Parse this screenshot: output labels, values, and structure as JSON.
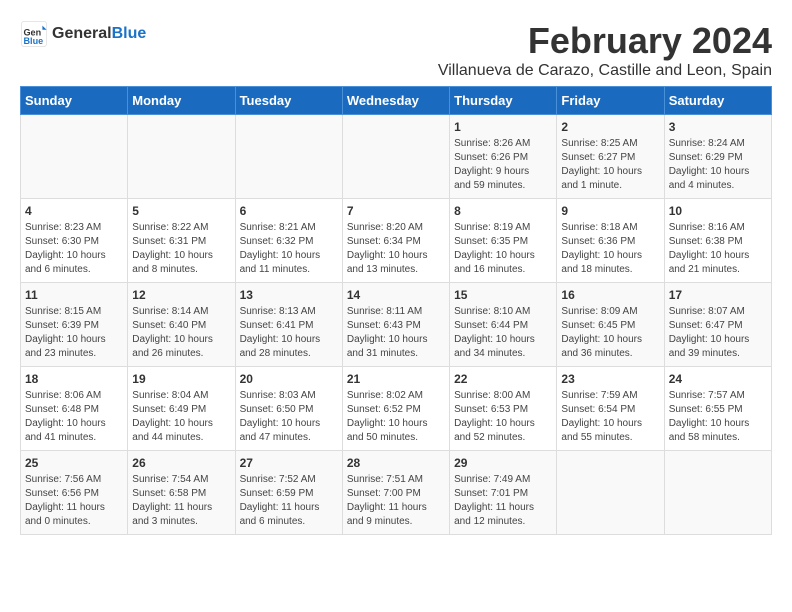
{
  "header": {
    "logo_general": "General",
    "logo_blue": "Blue",
    "title": "February 2024",
    "subtitle": "Villanueva de Carazo, Castille and Leon, Spain"
  },
  "days_of_week": [
    "Sunday",
    "Monday",
    "Tuesday",
    "Wednesday",
    "Thursday",
    "Friday",
    "Saturday"
  ],
  "weeks": [
    {
      "days": [
        {
          "number": "",
          "info": ""
        },
        {
          "number": "",
          "info": ""
        },
        {
          "number": "",
          "info": ""
        },
        {
          "number": "",
          "info": ""
        },
        {
          "number": "1",
          "info": "Sunrise: 8:26 AM\nSunset: 6:26 PM\nDaylight: 9 hours\nand 59 minutes."
        },
        {
          "number": "2",
          "info": "Sunrise: 8:25 AM\nSunset: 6:27 PM\nDaylight: 10 hours\nand 1 minute."
        },
        {
          "number": "3",
          "info": "Sunrise: 8:24 AM\nSunset: 6:29 PM\nDaylight: 10 hours\nand 4 minutes."
        }
      ]
    },
    {
      "days": [
        {
          "number": "4",
          "info": "Sunrise: 8:23 AM\nSunset: 6:30 PM\nDaylight: 10 hours\nand 6 minutes."
        },
        {
          "number": "5",
          "info": "Sunrise: 8:22 AM\nSunset: 6:31 PM\nDaylight: 10 hours\nand 8 minutes."
        },
        {
          "number": "6",
          "info": "Sunrise: 8:21 AM\nSunset: 6:32 PM\nDaylight: 10 hours\nand 11 minutes."
        },
        {
          "number": "7",
          "info": "Sunrise: 8:20 AM\nSunset: 6:34 PM\nDaylight: 10 hours\nand 13 minutes."
        },
        {
          "number": "8",
          "info": "Sunrise: 8:19 AM\nSunset: 6:35 PM\nDaylight: 10 hours\nand 16 minutes."
        },
        {
          "number": "9",
          "info": "Sunrise: 8:18 AM\nSunset: 6:36 PM\nDaylight: 10 hours\nand 18 minutes."
        },
        {
          "number": "10",
          "info": "Sunrise: 8:16 AM\nSunset: 6:38 PM\nDaylight: 10 hours\nand 21 minutes."
        }
      ]
    },
    {
      "days": [
        {
          "number": "11",
          "info": "Sunrise: 8:15 AM\nSunset: 6:39 PM\nDaylight: 10 hours\nand 23 minutes."
        },
        {
          "number": "12",
          "info": "Sunrise: 8:14 AM\nSunset: 6:40 PM\nDaylight: 10 hours\nand 26 minutes."
        },
        {
          "number": "13",
          "info": "Sunrise: 8:13 AM\nSunset: 6:41 PM\nDaylight: 10 hours\nand 28 minutes."
        },
        {
          "number": "14",
          "info": "Sunrise: 8:11 AM\nSunset: 6:43 PM\nDaylight: 10 hours\nand 31 minutes."
        },
        {
          "number": "15",
          "info": "Sunrise: 8:10 AM\nSunset: 6:44 PM\nDaylight: 10 hours\nand 34 minutes."
        },
        {
          "number": "16",
          "info": "Sunrise: 8:09 AM\nSunset: 6:45 PM\nDaylight: 10 hours\nand 36 minutes."
        },
        {
          "number": "17",
          "info": "Sunrise: 8:07 AM\nSunset: 6:47 PM\nDaylight: 10 hours\nand 39 minutes."
        }
      ]
    },
    {
      "days": [
        {
          "number": "18",
          "info": "Sunrise: 8:06 AM\nSunset: 6:48 PM\nDaylight: 10 hours\nand 41 minutes."
        },
        {
          "number": "19",
          "info": "Sunrise: 8:04 AM\nSunset: 6:49 PM\nDaylight: 10 hours\nand 44 minutes."
        },
        {
          "number": "20",
          "info": "Sunrise: 8:03 AM\nSunset: 6:50 PM\nDaylight: 10 hours\nand 47 minutes."
        },
        {
          "number": "21",
          "info": "Sunrise: 8:02 AM\nSunset: 6:52 PM\nDaylight: 10 hours\nand 50 minutes."
        },
        {
          "number": "22",
          "info": "Sunrise: 8:00 AM\nSunset: 6:53 PM\nDaylight: 10 hours\nand 52 minutes."
        },
        {
          "number": "23",
          "info": "Sunrise: 7:59 AM\nSunset: 6:54 PM\nDaylight: 10 hours\nand 55 minutes."
        },
        {
          "number": "24",
          "info": "Sunrise: 7:57 AM\nSunset: 6:55 PM\nDaylight: 10 hours\nand 58 minutes."
        }
      ]
    },
    {
      "days": [
        {
          "number": "25",
          "info": "Sunrise: 7:56 AM\nSunset: 6:56 PM\nDaylight: 11 hours\nand 0 minutes."
        },
        {
          "number": "26",
          "info": "Sunrise: 7:54 AM\nSunset: 6:58 PM\nDaylight: 11 hours\nand 3 minutes."
        },
        {
          "number": "27",
          "info": "Sunrise: 7:52 AM\nSunset: 6:59 PM\nDaylight: 11 hours\nand 6 minutes."
        },
        {
          "number": "28",
          "info": "Sunrise: 7:51 AM\nSunset: 7:00 PM\nDaylight: 11 hours\nand 9 minutes."
        },
        {
          "number": "29",
          "info": "Sunrise: 7:49 AM\nSunset: 7:01 PM\nDaylight: 11 hours\nand 12 minutes."
        },
        {
          "number": "",
          "info": ""
        },
        {
          "number": "",
          "info": ""
        }
      ]
    }
  ]
}
